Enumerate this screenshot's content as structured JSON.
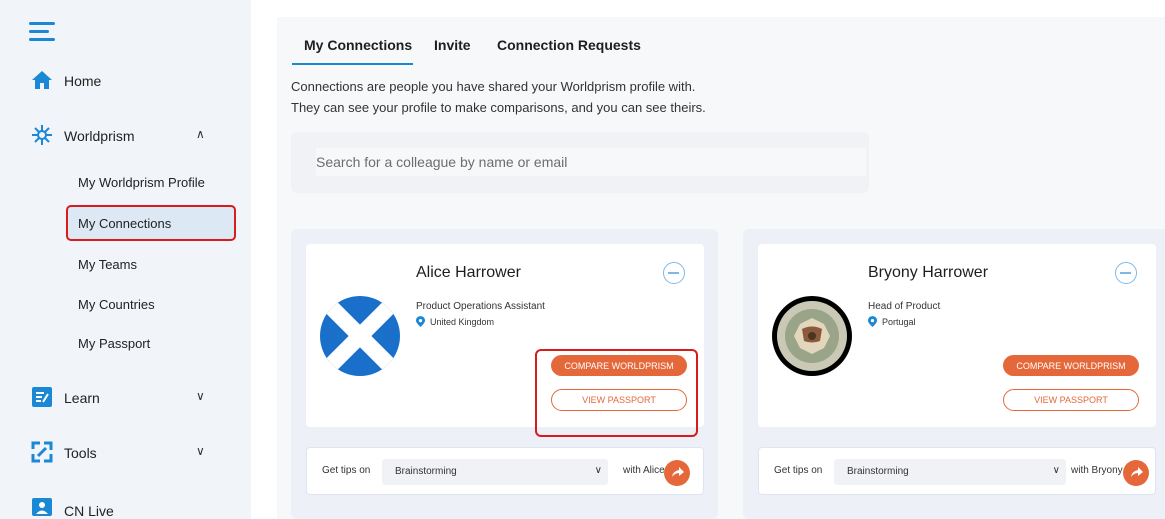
{
  "sidebar": {
    "home": "Home",
    "worldprism": "Worldprism",
    "sub_items": [
      "My Worldprism Profile",
      "My Connections",
      "My Teams",
      "My Countries",
      "My Passport"
    ],
    "learn": "Learn",
    "tools": "Tools",
    "cn_live": "CN Live"
  },
  "tabs": [
    "My Connections",
    "Invite",
    "Connection Requests"
  ],
  "intro": {
    "line1": "Connections are people you have shared your Worldprism profile with.",
    "line2": "They can see your profile to make comparisons, and you can see theirs."
  },
  "search": {
    "placeholder": "Search for a colleague by name or email"
  },
  "connections": [
    {
      "name": "Alice Harrower",
      "role": "Product Operations Assistant",
      "location": "United Kingdom",
      "compare_label": "COMPARE WORLDPRISM",
      "view_label": "VIEW PASSPORT",
      "tips_label": "Get tips on",
      "tips_topic": "Brainstorming",
      "tips_with": "with Alice"
    },
    {
      "name": "Bryony Harrower",
      "role": "Head of Product",
      "location": "Portugal",
      "compare_label": "COMPARE WORLDPRISM",
      "view_label": "VIEW PASSPORT",
      "tips_label": "Get tips on",
      "tips_topic": "Brainstorming",
      "tips_with": "with Bryony"
    }
  ],
  "colors": {
    "accent": "#1b88d6",
    "action": "#e5683b",
    "highlight": "#d81b1b"
  }
}
